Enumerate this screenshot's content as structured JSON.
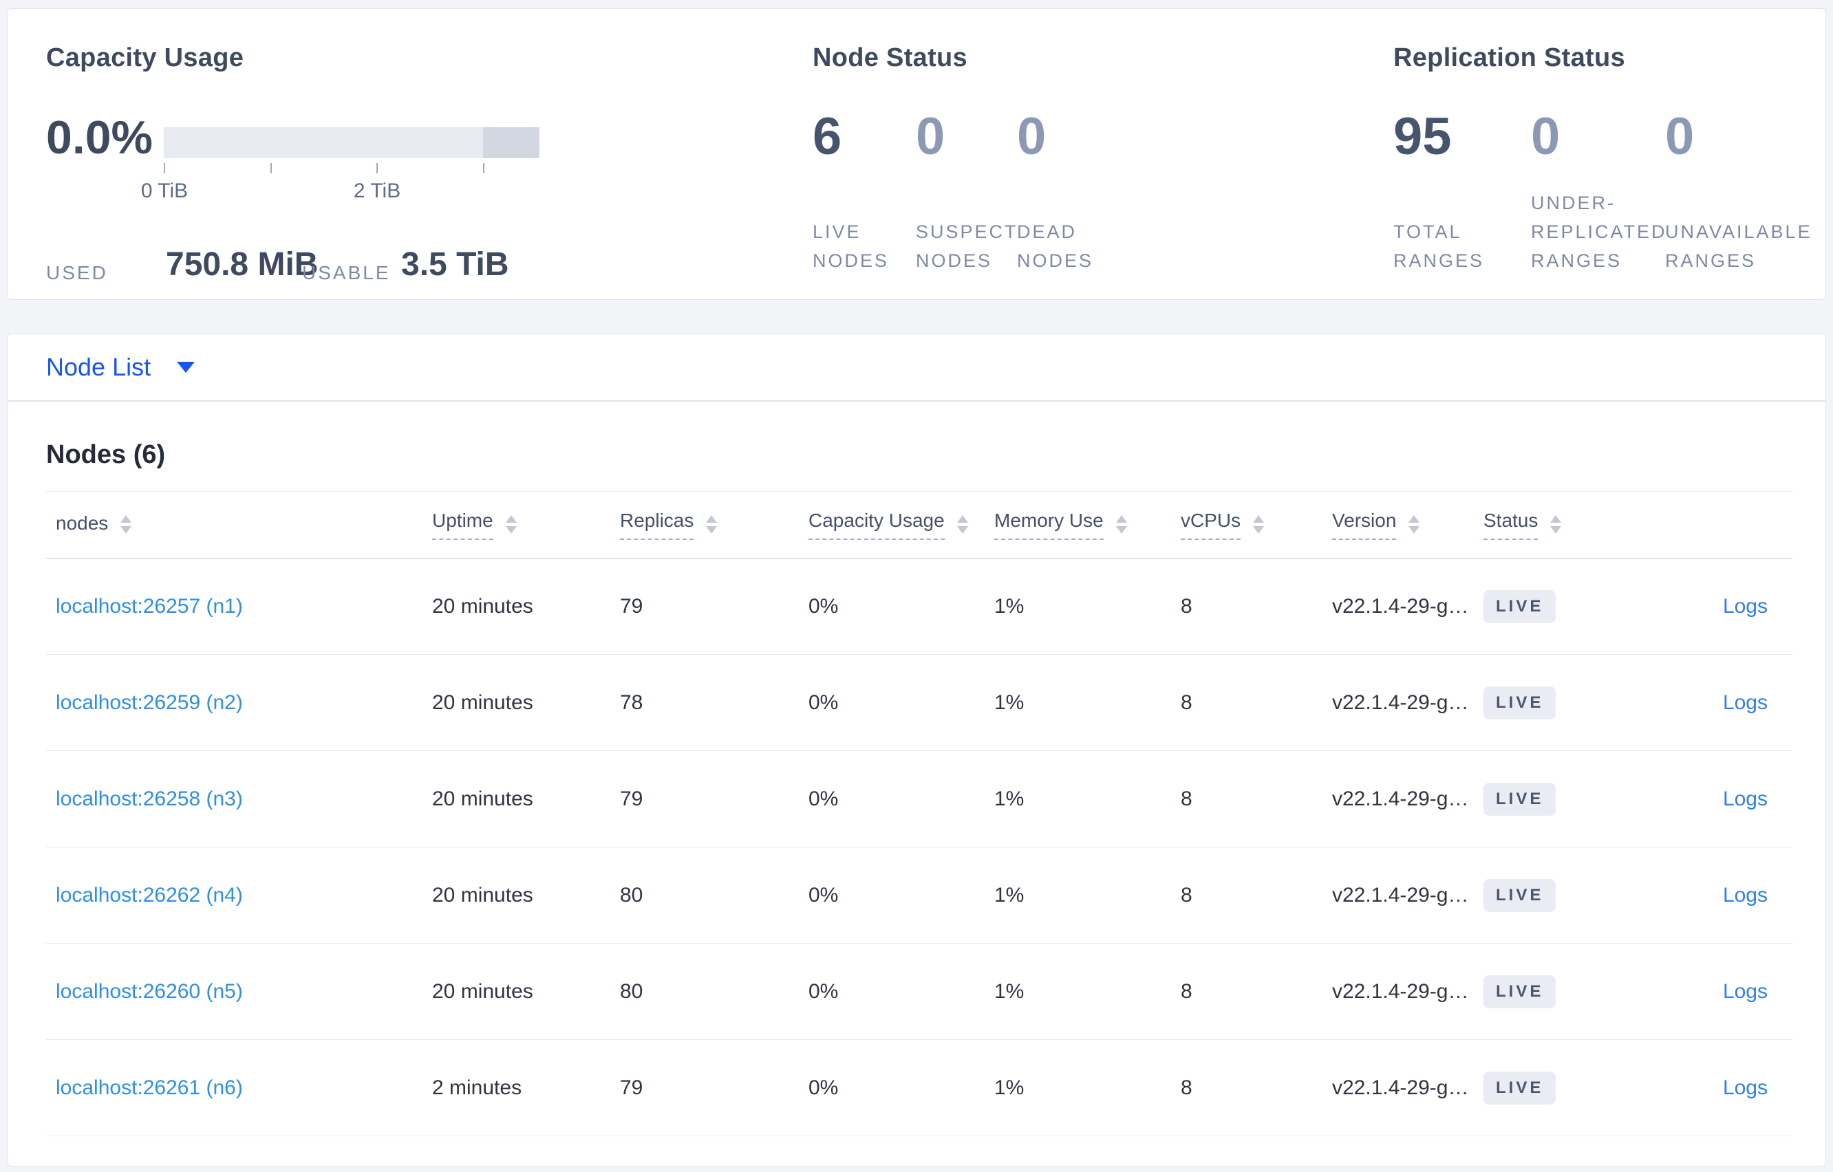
{
  "summary": {
    "capacity": {
      "title": "Capacity Usage",
      "percent": "0.0%",
      "used_label": "USED",
      "used_value": "750.8 MiB",
      "usable_label": "USABLE",
      "usable_value": "3.5 TiB",
      "bar": {
        "light_color": "#e8eaf1",
        "dark_color": "#d3d7e1",
        "dark_segment_start_frac": 0.85,
        "ticks": [
          {
            "frac": 0.0,
            "label": "0 TiB"
          },
          {
            "frac": 0.284,
            "label": ""
          },
          {
            "frac": 0.566,
            "label": "2 TiB"
          },
          {
            "frac": 0.85,
            "label": ""
          }
        ]
      }
    },
    "node_status": {
      "title": "Node Status",
      "stats": [
        {
          "value": "6",
          "label": "LIVE NODES"
        },
        {
          "value": "0",
          "label": "SUSPECT NODES"
        },
        {
          "value": "0",
          "label": "DEAD NODES"
        }
      ]
    },
    "replication": {
      "title": "Replication Status",
      "stats": [
        {
          "value": "95",
          "label": "TOTAL RANGES"
        },
        {
          "value": "0",
          "label": "UNDER-REPLICATED RANGES"
        },
        {
          "value": "0",
          "label": "UNAVAILABLE RANGES"
        }
      ]
    }
  },
  "node_list": {
    "label": "Node List"
  },
  "table": {
    "title": "Nodes (6)",
    "columns": [
      {
        "label": "nodes",
        "dashed": false
      },
      {
        "label": "Uptime",
        "dashed": true
      },
      {
        "label": "Replicas",
        "dashed": true
      },
      {
        "label": "Capacity Usage",
        "dashed": true
      },
      {
        "label": "Memory Use",
        "dashed": true
      },
      {
        "label": "vCPUs",
        "dashed": true
      },
      {
        "label": "Version",
        "dashed": true
      },
      {
        "label": "Status",
        "dashed": true
      }
    ],
    "rows": [
      {
        "node": "localhost:26257 (n1)",
        "uptime": "20 minutes",
        "replicas": "79",
        "capacity": "0%",
        "memory": "1%",
        "vcpus": "8",
        "version": "v22.1.4-29-g…",
        "status": "LIVE",
        "logs": "Logs"
      },
      {
        "node": "localhost:26259 (n2)",
        "uptime": "20 minutes",
        "replicas": "78",
        "capacity": "0%",
        "memory": "1%",
        "vcpus": "8",
        "version": "v22.1.4-29-g…",
        "status": "LIVE",
        "logs": "Logs"
      },
      {
        "node": "localhost:26258 (n3)",
        "uptime": "20 minutes",
        "replicas": "79",
        "capacity": "0%",
        "memory": "1%",
        "vcpus": "8",
        "version": "v22.1.4-29-g…",
        "status": "LIVE",
        "logs": "Logs"
      },
      {
        "node": "localhost:26262 (n4)",
        "uptime": "20 minutes",
        "replicas": "80",
        "capacity": "0%",
        "memory": "1%",
        "vcpus": "8",
        "version": "v22.1.4-29-g…",
        "status": "LIVE",
        "logs": "Logs"
      },
      {
        "node": "localhost:26260 (n5)",
        "uptime": "20 minutes",
        "replicas": "80",
        "capacity": "0%",
        "memory": "1%",
        "vcpus": "8",
        "version": "v22.1.4-29-g…",
        "status": "LIVE",
        "logs": "Logs"
      },
      {
        "node": "localhost:26261 (n6)",
        "uptime": "2 minutes",
        "replicas": "79",
        "capacity": "0%",
        "memory": "1%",
        "vcpus": "8",
        "version": "v22.1.4-29-g…",
        "status": "LIVE",
        "logs": "Logs"
      }
    ]
  },
  "colors": {
    "accent_blue": "#1657f3",
    "link_blue": "#2b8ef0",
    "badge_bg": "#e9edf3",
    "heading": "#3e4a5e",
    "muted_label": "#7e8aa5",
    "page_bg": "#f2f4f8"
  }
}
